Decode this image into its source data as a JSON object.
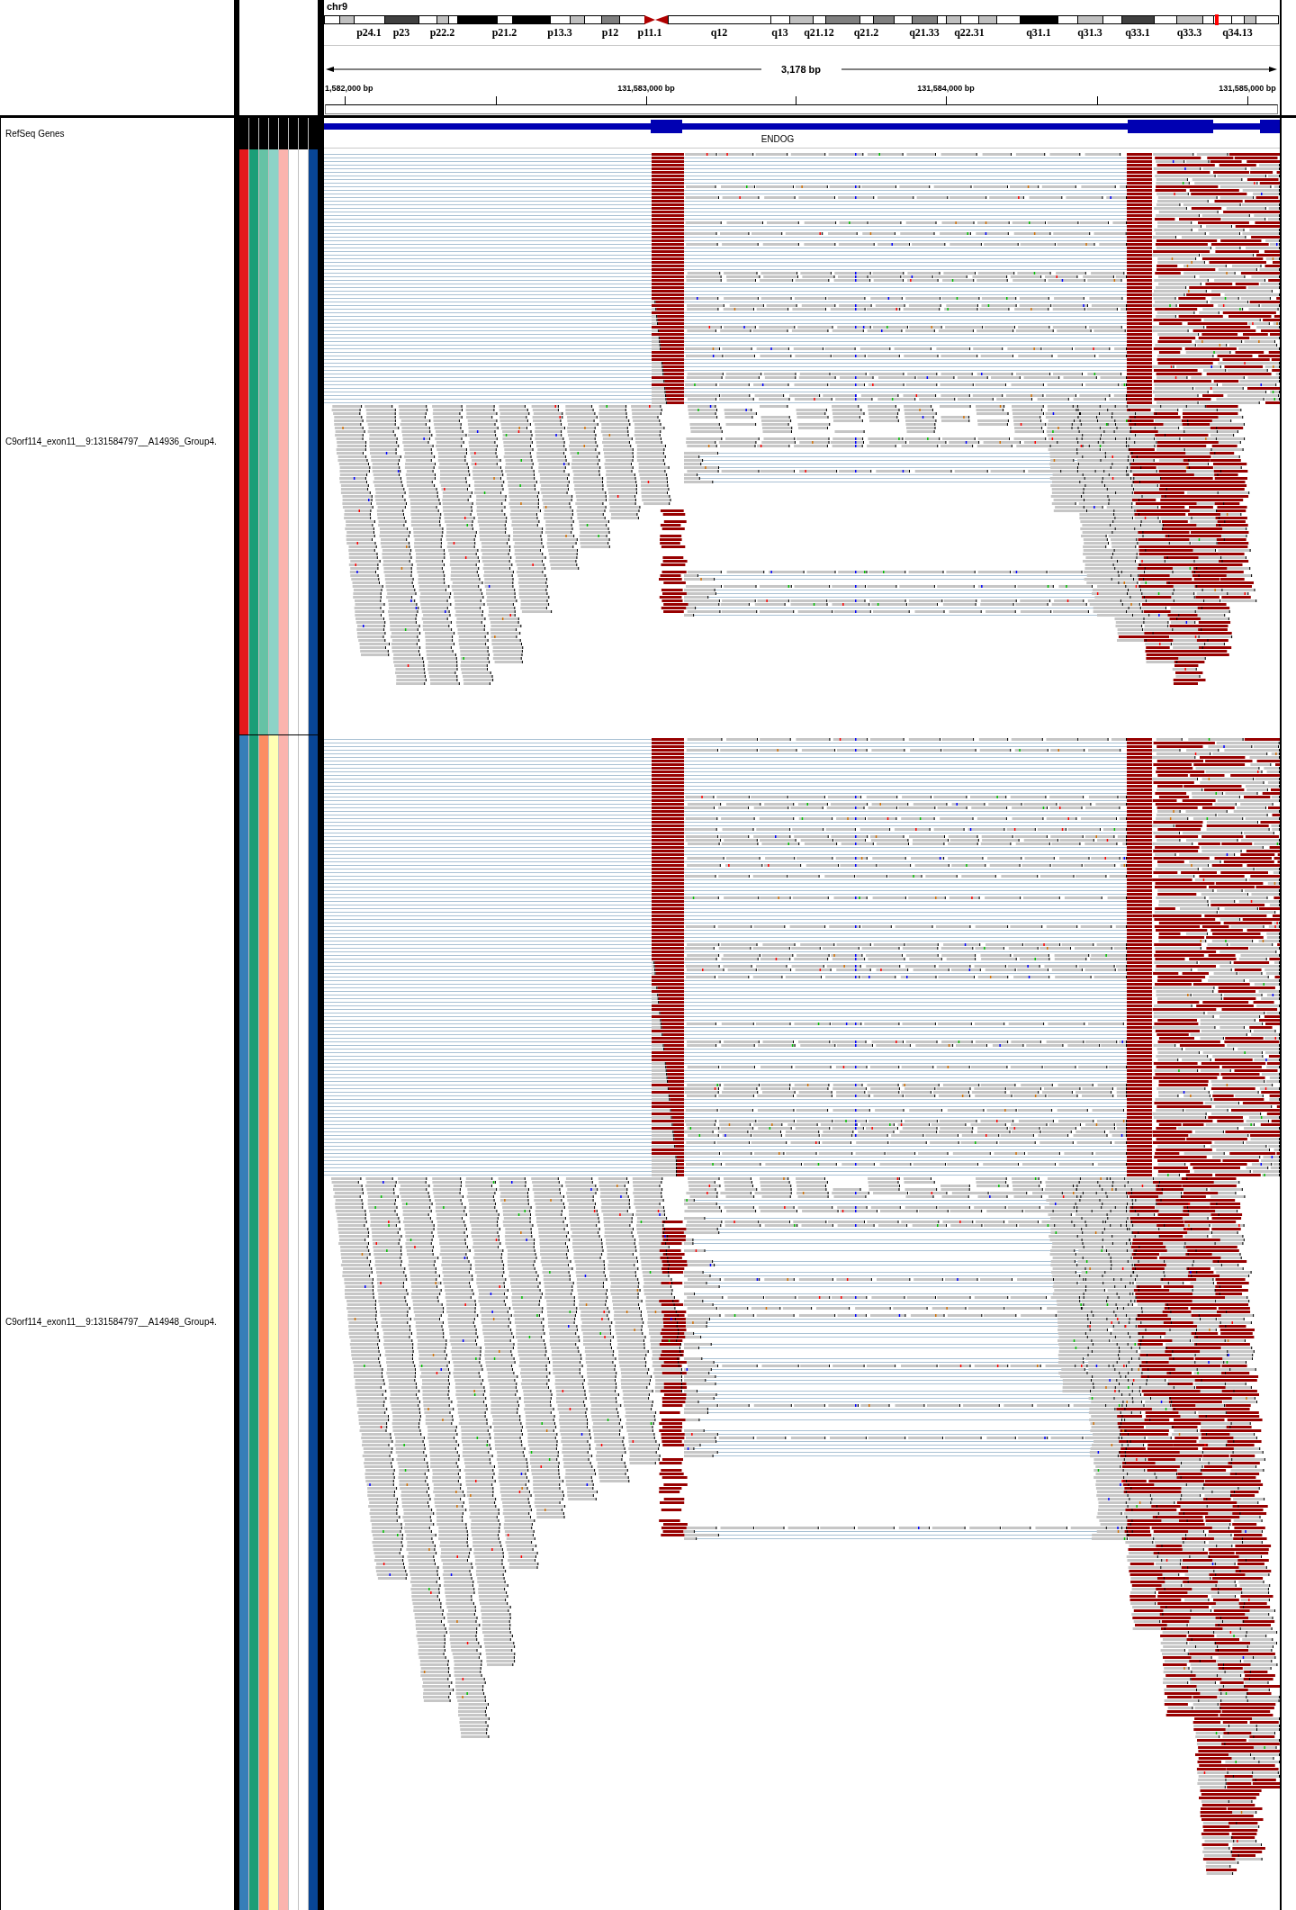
{
  "header": {
    "chromosome": "chr9",
    "ideogram": {
      "bands": [
        {
          "kind": "band",
          "color": "#ffffff"
        },
        {
          "kind": "band",
          "color": "#c0c0c0"
        },
        {
          "kind": "band",
          "color": "#ffffff",
          "label": "p24.1"
        },
        {
          "kind": "band",
          "color": "#404040",
          "label": "p23"
        },
        {
          "kind": "band",
          "color": "#ffffff"
        },
        {
          "kind": "band",
          "color": "#c0c0c0",
          "label": "p22.2"
        },
        {
          "kind": "band",
          "color": "#ffffff"
        },
        {
          "kind": "band",
          "color": "#000000"
        },
        {
          "kind": "band",
          "color": "#ffffff",
          "label": "p21.2"
        },
        {
          "kind": "band",
          "color": "#000000"
        },
        {
          "kind": "band",
          "color": "#ffffff",
          "label": "p13.3"
        },
        {
          "kind": "band",
          "color": "#c0c0c0"
        },
        {
          "kind": "band",
          "color": "#ffffff"
        },
        {
          "kind": "band",
          "color": "#808080",
          "label": "p12"
        },
        {
          "kind": "band",
          "color": "#ffffff"
        },
        {
          "kind": "centromere",
          "color": "#b00000",
          "label": "p11.1"
        },
        {
          "kind": "centromere",
          "color": "#b00000"
        },
        {
          "kind": "band",
          "color": "#ffffff",
          "label": "q12"
        },
        {
          "kind": "band",
          "color": "#ffffff",
          "label": "q13"
        },
        {
          "kind": "band",
          "color": "#c0c0c0"
        },
        {
          "kind": "band",
          "color": "#ffffff",
          "label": "q21.12"
        },
        {
          "kind": "band",
          "color": "#808080"
        },
        {
          "kind": "band",
          "color": "#ffffff",
          "label": "q21.2"
        },
        {
          "kind": "band",
          "color": "#808080"
        },
        {
          "kind": "band",
          "color": "#ffffff"
        },
        {
          "kind": "band",
          "color": "#808080",
          "label": "q21.33"
        },
        {
          "kind": "band",
          "color": "#ffffff"
        },
        {
          "kind": "band",
          "color": "#c0c0c0"
        },
        {
          "kind": "band",
          "color": "#ffffff",
          "label": "q22.31"
        },
        {
          "kind": "band",
          "color": "#c0c0c0"
        },
        {
          "kind": "band",
          "color": "#ffffff"
        },
        {
          "kind": "band",
          "color": "#000000",
          "label": "q31.1"
        },
        {
          "kind": "band",
          "color": "#ffffff"
        },
        {
          "kind": "band",
          "color": "#c0c0c0",
          "label": "q31.3"
        },
        {
          "kind": "band",
          "color": "#ffffff"
        },
        {
          "kind": "band",
          "color": "#404040",
          "label": "q33.1"
        },
        {
          "kind": "band",
          "color": "#ffffff"
        },
        {
          "kind": "band",
          "color": "#c0c0c0",
          "label": "q33.3"
        },
        {
          "kind": "band",
          "color": "#ffffff"
        },
        {
          "kind": "band",
          "color": "#ffffff"
        },
        {
          "kind": "band",
          "color": "#ffffff",
          "label": "q34.13"
        },
        {
          "kind": "band",
          "color": "#c0c0c0"
        },
        {
          "kind": "band",
          "color": "#ffffff"
        }
      ]
    },
    "ruler": {
      "span": "3,178 bp",
      "tick_labels": [
        "1,582,000 bp",
        "131,583,000 bp",
        "131,584,000 bp",
        "131,585,000 bp"
      ]
    }
  },
  "gene_track": {
    "name": "RefSeq Genes",
    "genes": [
      {
        "name": "ENDOG"
      }
    ]
  },
  "alignment_tracks": [
    {
      "name": "C9orf114_exon11__9:131584797__A14936_Group4.",
      "attributes": [
        {
          "color": "#e41a1c"
        },
        {
          "color": "#1b9e77"
        },
        {
          "color": "#66c2a5"
        },
        {
          "color": "#8dd3c7"
        },
        {
          "color": "#fbb4ae"
        },
        {
          "color": "#ffffff"
        },
        {
          "color": "#ffffff"
        },
        {
          "color": "#084594"
        }
      ]
    },
    {
      "name": "C9orf114_exon11__9:131584797__A14948_Group4.",
      "attributes": [
        {
          "color": "#377eb8"
        },
        {
          "color": "#1b9e77"
        },
        {
          "color": "#fc8d62"
        },
        {
          "color": "#ffffb3"
        },
        {
          "color": "#fbb4ae"
        },
        {
          "color": "#ffffff"
        },
        {
          "color": "#ffffff"
        },
        {
          "color": "#084594"
        }
      ]
    }
  ]
}
